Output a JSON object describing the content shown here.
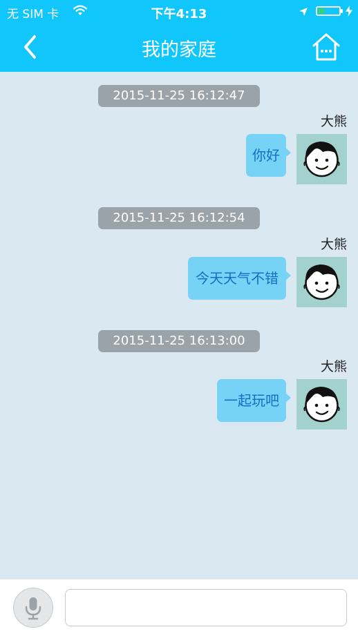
{
  "status_bar": {
    "carrier": "无 SIM 卡",
    "time": "下午4:13",
    "icons": [
      "wifi-icon",
      "location-arrow-icon",
      "battery-icon",
      "charging-bolt-icon"
    ],
    "battery_level": 0.3
  },
  "nav": {
    "title": "我的家庭",
    "back_icon": "chevron-left-icon",
    "home_icon": "home-icon"
  },
  "messages": [
    {
      "timestamp": "2015-11-25 16:12:47",
      "sender": "大熊",
      "text": "你好"
    },
    {
      "timestamp": "2015-11-25 16:12:54",
      "sender": "大熊",
      "text": "今天天气不错"
    },
    {
      "timestamp": "2015-11-25 16:13:00",
      "sender": "大熊",
      "text": "一起玩吧"
    }
  ],
  "input_bar": {
    "mic_icon": "microphone-icon",
    "message_value": "",
    "message_placeholder": ""
  },
  "colors": {
    "header": "#10c6fb",
    "background": "#d9e8f1",
    "bubble": "#76d3f5",
    "bubble_text": "#146fc4",
    "timestamp_bg": "#9aa3a9",
    "avatar_bg": "#a3d1ce"
  }
}
